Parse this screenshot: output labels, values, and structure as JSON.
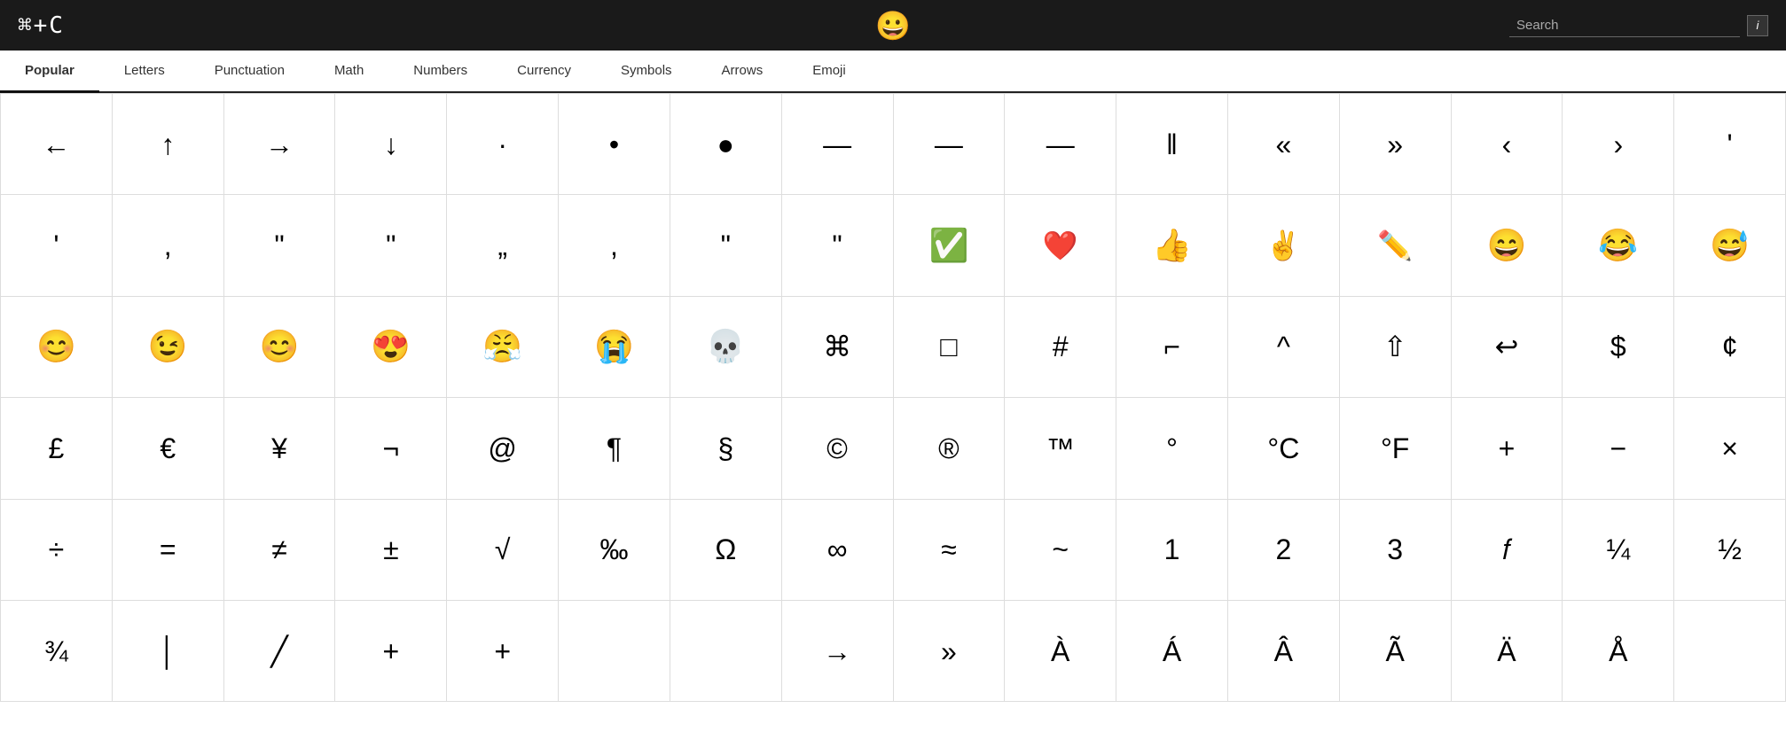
{
  "header": {
    "logo": "⌘+C",
    "center_icon": "😀",
    "search_placeholder": "Search",
    "info_label": "i"
  },
  "nav": {
    "tabs": [
      {
        "label": "Popular",
        "active": true
      },
      {
        "label": "Letters",
        "active": false
      },
      {
        "label": "Punctuation",
        "active": false
      },
      {
        "label": "Math",
        "active": false
      },
      {
        "label": "Numbers",
        "active": false
      },
      {
        "label": "Currency",
        "active": false
      },
      {
        "label": "Symbols",
        "active": false
      },
      {
        "label": "Arrows",
        "active": false
      },
      {
        "label": "Emoji",
        "active": false
      }
    ]
  },
  "grid": {
    "cells": [
      "←",
      "↑",
      "→",
      "↓",
      "·",
      "•",
      "●",
      "—",
      "—",
      "—",
      "‖",
      "«",
      "»",
      "‹",
      "›",
      "'",
      "'",
      ",",
      "\"",
      "\"",
      "„",
      ",",
      "\"",
      "\"",
      "✅",
      "❤️",
      "👍",
      "✌️",
      "✏️",
      "😄",
      "😂",
      "😅",
      "😊",
      "😉",
      "😊",
      "😍",
      "😤",
      "😭",
      "💀",
      "⌘",
      "□",
      "#",
      "⌐",
      "^",
      "⇧",
      "↩",
      "$",
      "¢",
      "£",
      "€",
      "¥",
      "¬",
      "@",
      "¶",
      "§",
      "©",
      "®",
      "™",
      "°",
      "°C",
      "°F",
      "+",
      "−",
      "×",
      "÷",
      "=",
      "≠",
      "±",
      "√",
      "‰",
      "Ω",
      "∞",
      "≈",
      "~",
      "1",
      "2",
      "3",
      "𝑓",
      "¼",
      "½",
      "¾",
      "│",
      "╱",
      "+",
      "+",
      "",
      "",
      "→",
      "»",
      "À",
      "Á",
      "Â",
      "Ã",
      "Ä",
      "Å",
      ""
    ]
  }
}
